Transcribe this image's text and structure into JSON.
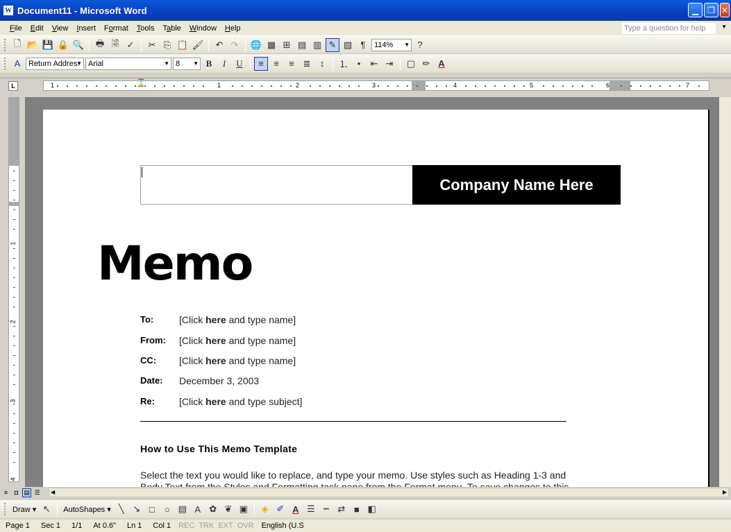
{
  "window": {
    "title": "Document11 - Microsoft Word",
    "icon_letter": "W"
  },
  "menubar": {
    "items": [
      {
        "label": "File",
        "ul": "F",
        "rest": "ile"
      },
      {
        "label": "Edit",
        "ul": "E",
        "rest": "dit"
      },
      {
        "label": "View",
        "ul": "V",
        "rest": "iew"
      },
      {
        "label": "Insert",
        "ul": "I",
        "rest": "nsert"
      },
      {
        "label": "Format",
        "pre": "F",
        "ul": "o",
        "rest": "rmat"
      },
      {
        "label": "Tools",
        "ul": "T",
        "rest": "ools"
      },
      {
        "label": "Table",
        "pre": "T",
        "ul": "a",
        "rest": "ble"
      },
      {
        "label": "Window",
        "ul": "W",
        "rest": "indow"
      },
      {
        "label": "Help",
        "ul": "H",
        "rest": "elp"
      }
    ],
    "help_placeholder": "Type a question for help"
  },
  "standard_toolbar": {
    "zoom": "114%"
  },
  "formatting_toolbar": {
    "style": "Return Addres:",
    "font": "Arial",
    "size": "8"
  },
  "ruler": {
    "numbers": [
      "1",
      "1",
      "2",
      "3",
      "4",
      "5",
      "6",
      "7"
    ]
  },
  "vruler": {
    "numbers": [
      "1",
      "2",
      "3",
      "4"
    ]
  },
  "document": {
    "company_name": "Company Name Here",
    "title": "Memo",
    "fields": [
      {
        "label": "To:",
        "pre": "[Click ",
        "bold": "here",
        "post": " and type name]"
      },
      {
        "label": "From:",
        "pre": "[Click ",
        "bold": "here",
        "post": " and type name]"
      },
      {
        "label": "CC:",
        "pre": "[Click ",
        "bold": "here",
        "post": " and type name]"
      },
      {
        "label": "Date:",
        "pre": "December 3, 2003",
        "bold": "",
        "post": ""
      },
      {
        "label": "Re:",
        "pre": "[Click ",
        "bold": "here",
        "post": " and type subject]"
      }
    ],
    "section_heading": "How to Use This Memo Template",
    "body_line1": "Select the text you would like to replace, and type your memo.  Use styles such as Heading 1-3 and",
    "body_line2": "Body Text from the Styles and Formatting task pane from the Format menu.  To save changes to this"
  },
  "drawbar": {
    "draw_label": "Draw",
    "autoshapes_label": "AutoShapes"
  },
  "statusbar": {
    "page": "Page 1",
    "sec": "Sec 1",
    "pages": "1/1",
    "at": "At 0.6\"",
    "ln": "Ln 1",
    "col": "Col 1",
    "rec": "REC",
    "trk": "TRK",
    "ext": "EXT",
    "ovr": "OVR",
    "lang": "English (U.S"
  }
}
